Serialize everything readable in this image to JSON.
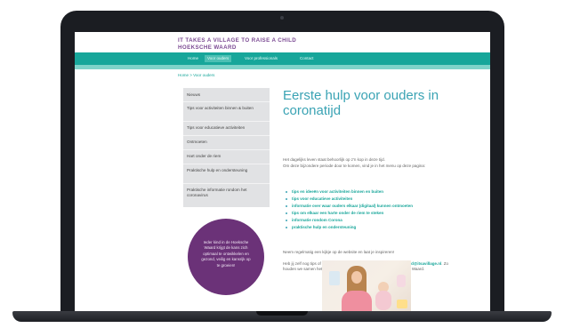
{
  "site": {
    "title_line1": "IT TAKES A VILLAGE TO RAISE A CHILD",
    "title_line2": "HOEKSCHE WAARD"
  },
  "nav": {
    "items": [
      {
        "label": "Home",
        "active": false
      },
      {
        "label": "Voor ouders",
        "active": true
      },
      {
        "label": "Voor professionals",
        "active": false
      },
      {
        "label": "Contact",
        "active": false
      }
    ]
  },
  "breadcrumb": "Home > Voor ouders",
  "sidebar": {
    "items": [
      "Nieuws",
      "Tips voor activiteiten binnen & buiten",
      "Tips voor educatieve activiteiten",
      "Ontmoeten",
      "Hart onder de riem",
      "Praktische hulp en ondersteuning",
      "Praktische informatie rondom het coronavirus"
    ]
  },
  "circle_text": "Ieder kind in de Hoeksche Waard krijgt de kans zich optimaal te ontwikkelen en gezond, veilig en kansrijk op te groeien!",
  "content": {
    "title": "Eerste hulp voor ouders in coronatijd",
    "intro_line1": "Het dagelijks leven staat behoorlijk op z'n kop in deze tijd.",
    "intro_line2": "Om deze bijzondere periode door te komen, vind je in het menu op deze pagina:",
    "list": [
      "tips en ideeën voor activiteiten binnen en buiten",
      "tips voor educatieve activiteiten",
      "informatie over waar ouders elkaar (digitaal) kunnen ontmoeten",
      "tips om elkaar een harte onder de riem te steken",
      "informatie rondom Corona",
      "praktische hulp en ondersteuning"
    ],
    "para2": "Neem regelmatig een kijkje op de website en laat je inspireren!",
    "para3_line1": "Heb jij zelf nog tips of ideeën? Deel dan een e-mail naar",
    "para3_email": "hoekschewaard@itsavillage.nl",
    "para3_rest": ". Zo houden we samen het platform interessant voor ouders uit de Hoeksche Waard."
  },
  "icons": {
    "camera": "laptop-camera",
    "bullet": "list-bullet"
  },
  "colors": {
    "nav": "#17a69a",
    "title": "#3aa3b4",
    "purple": "#6b3278",
    "site_title": "#7b4a93"
  }
}
